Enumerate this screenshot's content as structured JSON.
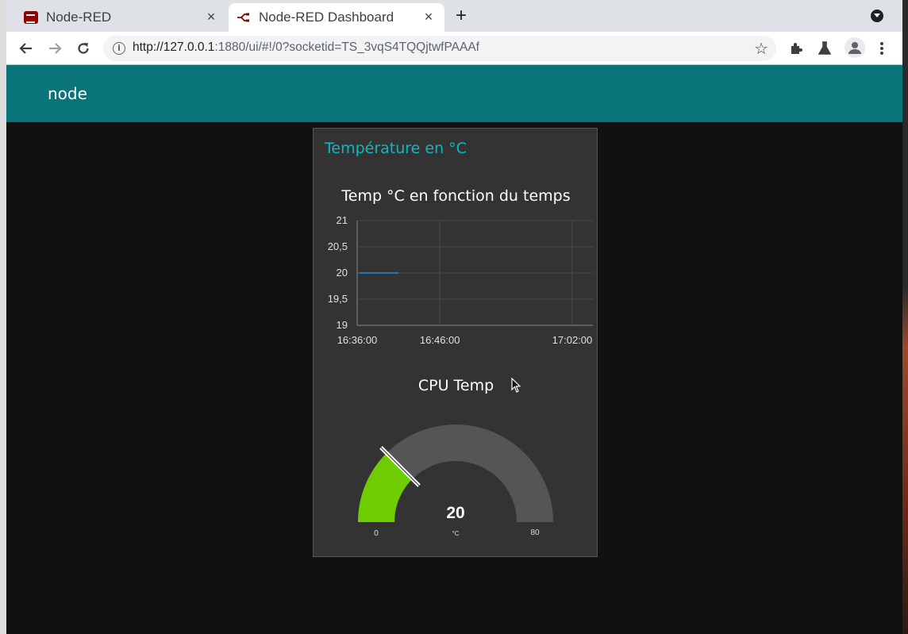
{
  "browser": {
    "tabs": [
      {
        "title": "Node-RED",
        "active": false
      },
      {
        "title": "Node-RED Dashboard",
        "active": true
      }
    ],
    "url_host": "http://127.0.0.1",
    "url_rest": ":1880/ui/#!/0?socketid=TS_3vqS4TQQjtwfPAAAf",
    "new_tab_label": "+",
    "close_label": "×"
  },
  "dashboard": {
    "title": "node",
    "header_color": "#097479",
    "group_title": "Température en °C",
    "accent_color": "#0eb8c0"
  },
  "chart_data": [
    {
      "type": "line",
      "title": "Temp °C en fonction du temps",
      "xlabel": "",
      "ylabel": "",
      "y_ticks": [
        "21",
        "20,5",
        "20",
        "19,5",
        "19"
      ],
      "x_ticks": [
        "16:36:00",
        "16:46:00",
        "17:02:00"
      ],
      "ylim": [
        19,
        21
      ],
      "x_domain_minutes": [
        "16:36:00",
        "17:04:30"
      ],
      "x_tick_times": [
        "16:36:00",
        "16:46:00",
        "17:02:00"
      ],
      "grid": true,
      "series": [
        {
          "color": "#1f77b4",
          "x": [
            "16:36:12",
            "16:41:00"
          ],
          "y": [
            20,
            20
          ]
        }
      ]
    },
    {
      "type": "gauge",
      "title": "CPU Temp",
      "value": 20,
      "value_label": "20",
      "unit": "°C",
      "min": 0,
      "max": 80,
      "min_label": "0",
      "max_label": "80",
      "fill_color": "#6fcc00",
      "track_color": "#555555"
    }
  ]
}
